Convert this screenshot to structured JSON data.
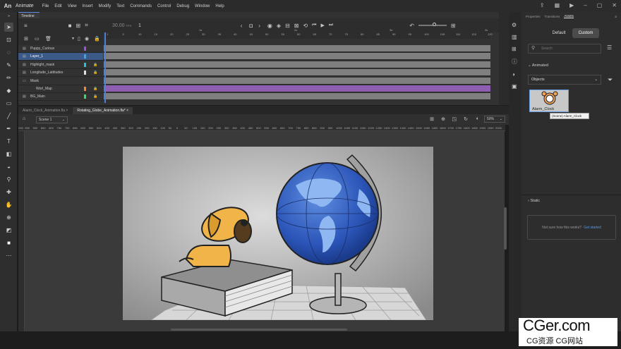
{
  "app": {
    "name": "Animate",
    "logo": "An"
  },
  "menu": [
    "File",
    "Edit",
    "View",
    "Insert",
    "Modify",
    "Text",
    "Commands",
    "Control",
    "Debug",
    "Window",
    "Help"
  ],
  "timeline": {
    "tab_label": "Timeline",
    "fps": "30.00",
    "fps_unit": "FPS",
    "current_frame": "1",
    "frame_ticks": [
      "1",
      "5",
      "10",
      "15",
      "20",
      "25",
      "30",
      "35",
      "40",
      "45",
      "50",
      "55",
      "60",
      "65",
      "70",
      "75",
      "80",
      "85",
      "90",
      "95",
      "100",
      "105",
      "110",
      "115",
      "120"
    ],
    "seconds": [
      "1s",
      "2s",
      "3s",
      "4s"
    ],
    "layers": [
      {
        "name": "Puppy_Curious",
        "color": "#a04fe0",
        "locked": false,
        "indent": 0,
        "selected": false
      },
      {
        "name": "Layer_1",
        "color": "#33a8f0",
        "locked": false,
        "indent": 0,
        "selected": true
      },
      {
        "name": "Highlight_mask",
        "color": "#23c3e0",
        "locked": true,
        "indent": 0,
        "selected": false
      },
      {
        "name": "Longitude_Lattitudes",
        "color": "#e0e0e0",
        "locked": true,
        "indent": 0,
        "selected": false
      },
      {
        "name": "Mask",
        "color": "",
        "locked": false,
        "indent": 0,
        "selected": false
      },
      {
        "name": "Worl_Map",
        "color": "#ef8b2c",
        "locked": true,
        "indent": 1,
        "selected": false
      },
      {
        "name": "BG_Main",
        "color": "#2ce06a",
        "locked": true,
        "indent": 0,
        "selected": false
      }
    ]
  },
  "documents": {
    "tabs": [
      "Alarm_Clock_Animation.fla",
      "Rotating_Globe_Animation.fla*"
    ],
    "active": 1
  },
  "editbar": {
    "scene": "Scene 1",
    "zoom": "50%"
  },
  "ruler_ticks": [
    "1000",
    "950",
    "900",
    "850",
    "800",
    "750",
    "700",
    "650",
    "600",
    "550",
    "500",
    "450",
    "400",
    "350",
    "300",
    "250",
    "200",
    "150",
    "100",
    "50",
    "0",
    "50",
    "100",
    "150",
    "200",
    "250",
    "300",
    "350",
    "400",
    "450",
    "500",
    "550",
    "600",
    "650",
    "700",
    "750",
    "800",
    "850",
    "900",
    "950",
    "1000",
    "1050",
    "1100",
    "1150",
    "1200",
    "1250",
    "1300",
    "1350",
    "1400",
    "1450",
    "1500",
    "1550",
    "1600",
    "1650",
    "1700",
    "1750",
    "1800",
    "1850",
    "1900",
    "1950",
    "2000"
  ],
  "right_panel": {
    "tabs": [
      "Properties",
      "Transitions",
      "Assets"
    ],
    "active_tab": 2,
    "segments": [
      "Default",
      "Custom"
    ],
    "active_segment": 1,
    "search_placeholder": "Search",
    "animated_label": "Animated",
    "filter_value": "Objects",
    "asset_name": "Alarm_Clock",
    "asset_tooltip": "(Scene) Alarm_Clock",
    "static_label": "Static",
    "help_text": "Not sure how this works?",
    "help_link": "Get started"
  },
  "watermark": {
    "line1": "CGer.com",
    "line2": "CG资源 CG网站"
  },
  "colors": {
    "accent": "#4e7fd6",
    "selected_layer": "#3b5a87",
    "purple_row": "#8e5fb0",
    "link": "#4d9cf0"
  }
}
